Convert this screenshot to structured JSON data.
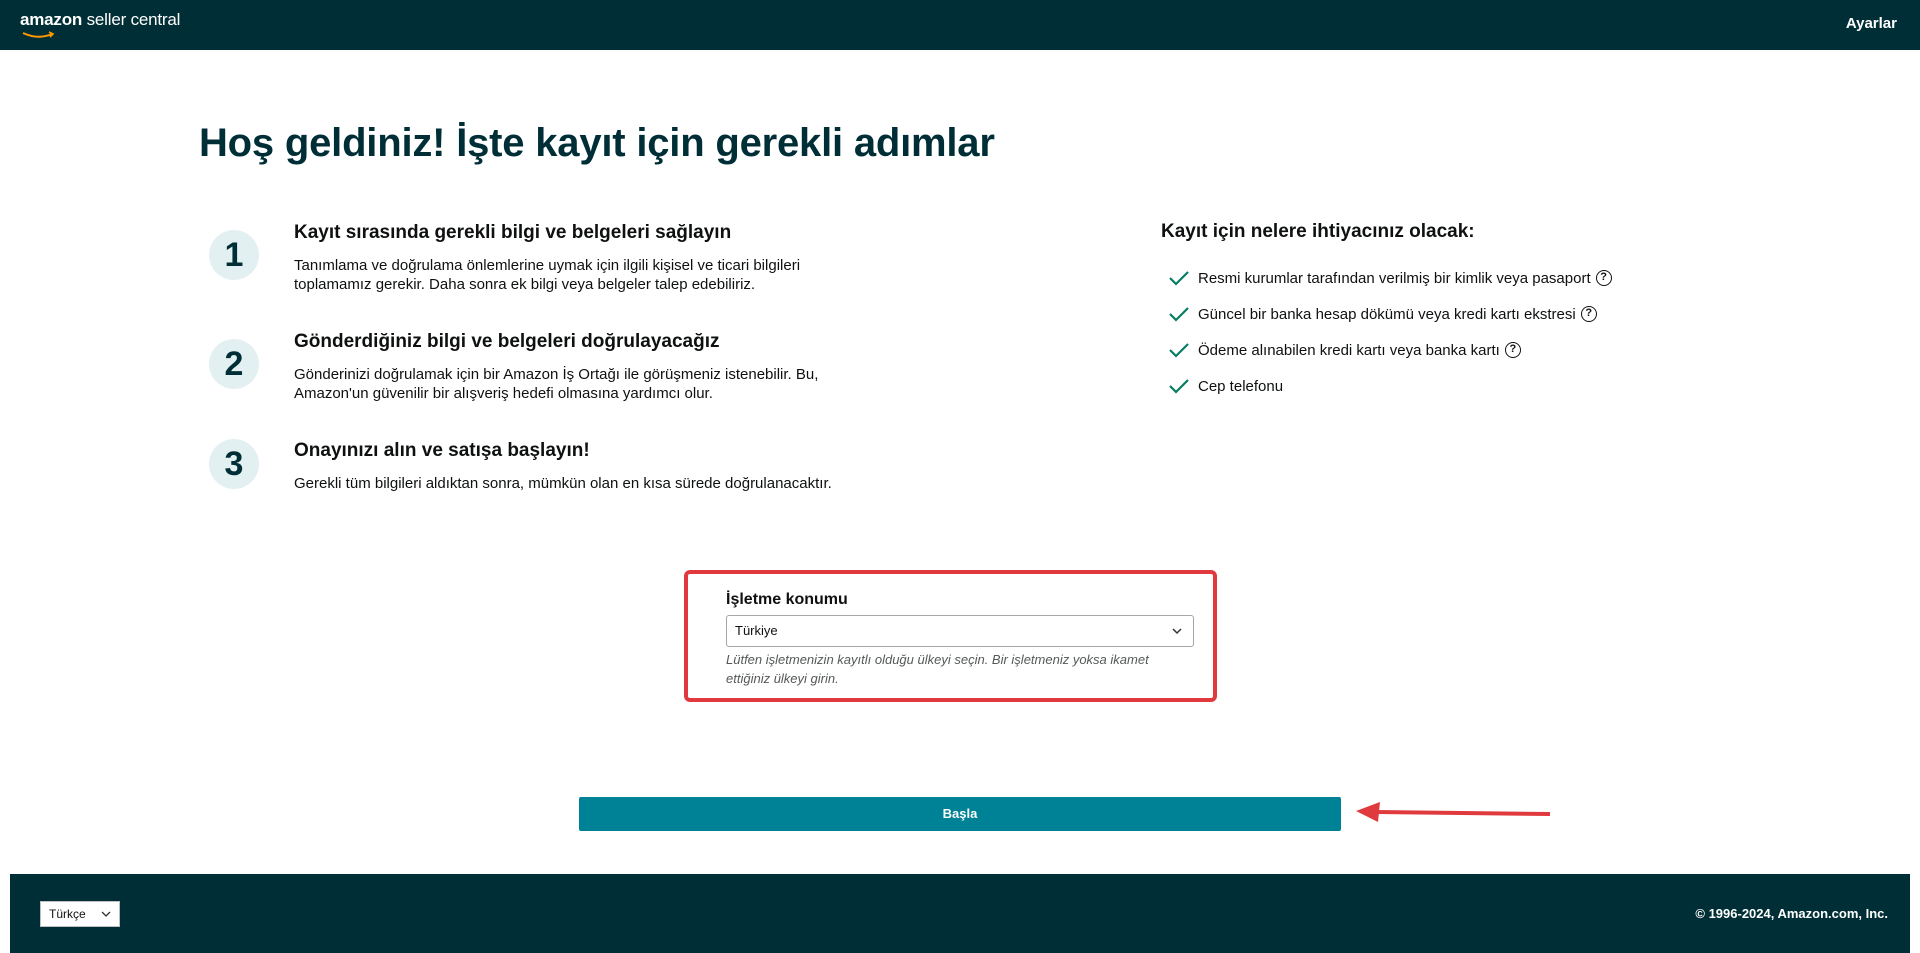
{
  "header": {
    "logo_brand": "amazon",
    "logo_suffix": " seller central",
    "settings_label": "Ayarlar"
  },
  "main": {
    "title": "Hoş geldiniz! İşte kayıt için gerekli adımlar",
    "steps": [
      {
        "number": "1",
        "title": "Kayıt sırasında gerekli bilgi ve belgeleri sağlayın",
        "description": "Tanımlama ve doğrulama önlemlerine uymak için ilgili kişisel ve ticari bilgileri toplamamız gerekir. Daha sonra ek bilgi veya belgeler talep edebiliriz."
      },
      {
        "number": "2",
        "title": "Gönderdiğiniz bilgi ve belgeleri doğrulayacağız",
        "description": "Gönderinizi doğrulamak için bir Amazon İş Ortağı ile görüşmeniz istenebilir. Bu, Amazon'un güvenilir bir alışveriş hedefi olmasına yardımcı olur."
      },
      {
        "number": "3",
        "title": "Onayınızı alın ve satışa başlayın!",
        "description": "Gerekli tüm bilgileri aldıktan sonra, mümkün olan en kısa sürede doğrulanacaktır."
      }
    ],
    "requirements": {
      "title": "Kayıt için nelere ihtiyacınız olacak:",
      "items": [
        {
          "label": "Resmi kurumlar tarafından verilmiş bir kimlik veya pasaport",
          "help": "?"
        },
        {
          "label": "Güncel bir banka hesap dökümü veya kredi kartı ekstresi",
          "help": "?"
        },
        {
          "label": "Ödeme alınabilen kredi kartı veya banka kartı",
          "help": "?"
        },
        {
          "label": "Cep telefonu"
        }
      ]
    },
    "business_location": {
      "label": "İşletme konumu",
      "selected": "Türkiye",
      "hint": "Lütfen işletmenizin kayıtlı olduğu ülkeyi seçin. Bir işletmeniz yoksa ikamet ettiğiniz ülkeyi girin."
    },
    "start_button": "Başla"
  },
  "footer": {
    "language": "Türkçe",
    "copyright": "© 1996-2024, Amazon.com, Inc."
  },
  "colors": {
    "header_bg": "#002e36",
    "button": "#008296",
    "check": "#067d62",
    "annotation": "#e03a3e"
  }
}
